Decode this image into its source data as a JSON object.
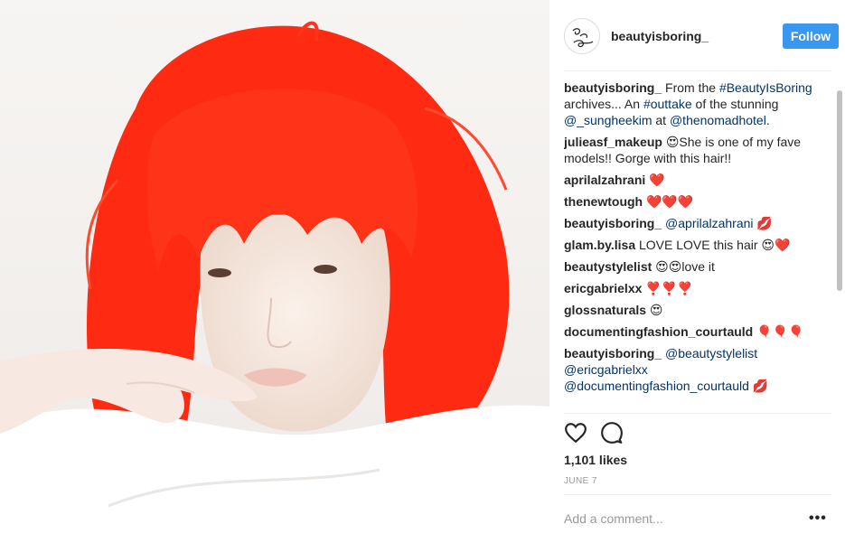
{
  "post": {
    "username": "beautyisboring_",
    "follow_label": "Follow",
    "avatar_text": "Beauty is Boring",
    "likes": "1,101 likes",
    "date": "JUNE 7",
    "comment_placeholder": "Add a comment...",
    "more_label": "•••"
  },
  "caption": {
    "user": "beautyisboring_",
    "t1": " From the ",
    "tag1": "#BeautyIsBoring",
    "t2": " archives... An ",
    "tag2": "#outtake",
    "t3": " of the stunning ",
    "mention1": "@_sungheekim",
    "t4": " at ",
    "mention2": "@thenomadhotel",
    "t5": "."
  },
  "comments": [
    {
      "user": "julieasf_makeup",
      "text": " 😍She is one of my fave models!! Gorge with this hair!!"
    },
    {
      "user": "aprilalzahrani",
      "text": " ❤️"
    },
    {
      "user": "thenewtough",
      "text": " ❤️❤️❤️"
    },
    {
      "user": "beautyisboring_",
      "mention": "@aprilalzahrani",
      "text": " 💋"
    },
    {
      "user": "glam.by.lisa",
      "text": " LOVE LOVE this hair 😍❤️"
    },
    {
      "user": "beautystylelist",
      "text": " 😍😍love it"
    },
    {
      "user": "ericgabrielxx",
      "text": " ❣️❣️❣️"
    },
    {
      "user": "glossnaturals",
      "text": " 😍"
    },
    {
      "user": "documentingfashion_courtauld",
      "text": " 🎈🎈🎈"
    }
  ],
  "last_comment": {
    "user": "beautyisboring_",
    "m1": "@beautystylelist",
    "m2": "@ericgabrielxx",
    "m3": "@documentingfashion_courtauld",
    "text": " 💋"
  },
  "colors": {
    "follow_button": "#3897f0",
    "link": "#003569",
    "hair": "#ff2a12"
  },
  "icons": [
    "heart-icon",
    "comment-icon",
    "more-options-icon"
  ]
}
